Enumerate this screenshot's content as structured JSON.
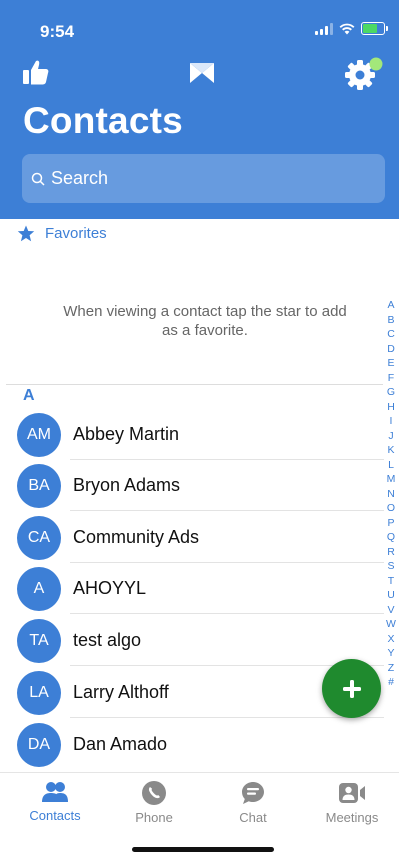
{
  "status_bar": {
    "time": "9:54"
  },
  "header": {
    "title": "Contacts",
    "search_placeholder": "Search"
  },
  "favorites": {
    "label": "Favorites",
    "empty_message": "When viewing a contact tap the star to add as a favorite."
  },
  "contacts": {
    "section_letter": "A",
    "items": [
      {
        "initials": "AM",
        "name": "Abbey Martin"
      },
      {
        "initials": "BA",
        "name": "Bryon Adams"
      },
      {
        "initials": "CA",
        "name": "Community Ads"
      },
      {
        "initials": "A",
        "name": "AHOYYL"
      },
      {
        "initials": "TA",
        "name": "test algo"
      },
      {
        "initials": "LA",
        "name": "Larry Althoff"
      },
      {
        "initials": "DA",
        "name": "Dan Amado"
      }
    ]
  },
  "alpha_index": [
    "A",
    "B",
    "C",
    "D",
    "E",
    "F",
    "G",
    "H",
    "I",
    "J",
    "K",
    "L",
    "M",
    "N",
    "O",
    "P",
    "Q",
    "R",
    "S",
    "T",
    "U",
    "V",
    "W",
    "X",
    "Y",
    "Z",
    "#"
  ],
  "tabbar": {
    "tabs": [
      {
        "label": "Contacts",
        "icon": "people-icon",
        "active": true
      },
      {
        "label": "Phone",
        "icon": "phone-icon",
        "active": false
      },
      {
        "label": "Chat",
        "icon": "chat-icon",
        "active": false
      },
      {
        "label": "Meetings",
        "icon": "meetings-icon",
        "active": false
      }
    ]
  },
  "colors": {
    "accent": "#3d7fd6",
    "fab": "#1f8a2e",
    "badge": "#a3e87a"
  }
}
